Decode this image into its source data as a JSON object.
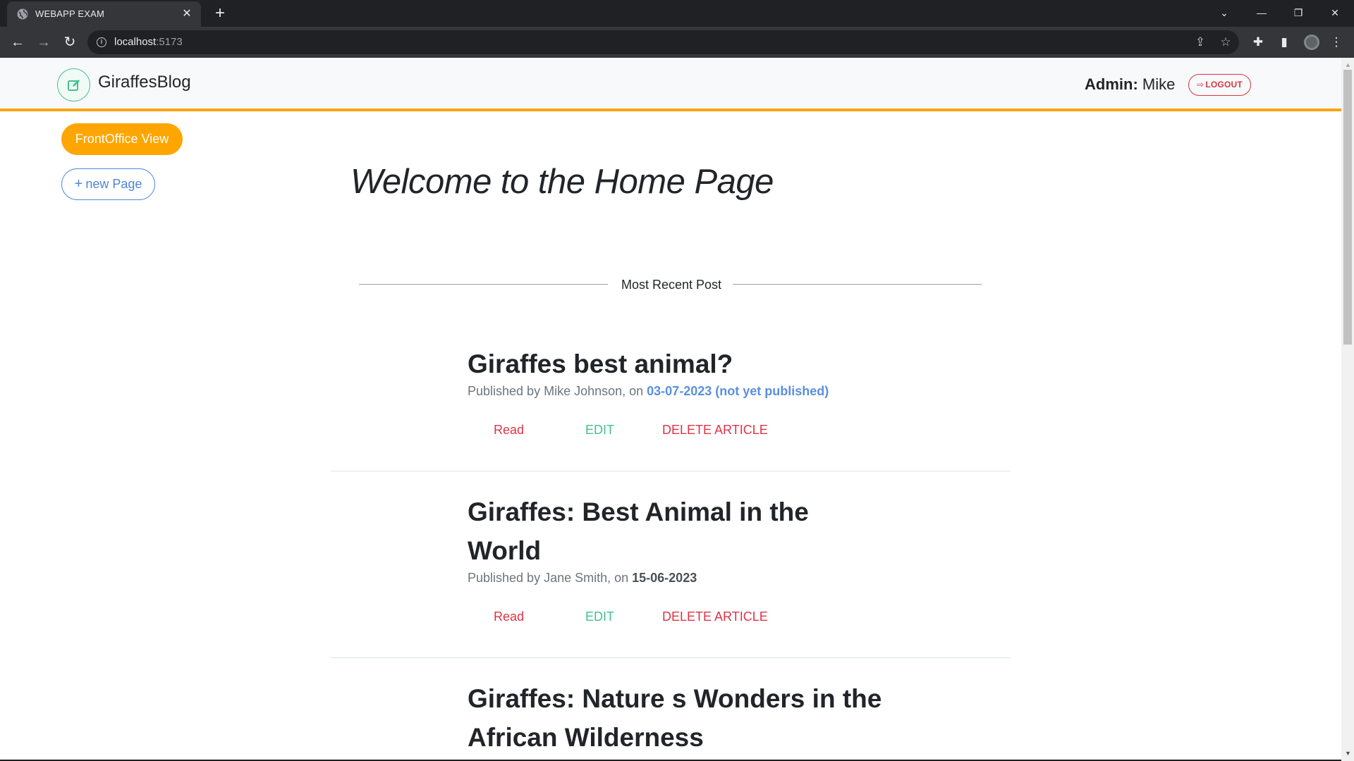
{
  "browser": {
    "tab_title": "WEBAPP EXAM",
    "tab_close": "✕",
    "new_tab": "+",
    "url_host": "localhost",
    "url_port": ":5173",
    "window_controls": {
      "chevron": "⌄",
      "minimize": "—",
      "restore": "❐",
      "close": "✕"
    }
  },
  "header": {
    "brand": "GiraffesBlog",
    "admin_label": "Admin:",
    "admin_name": "Mike",
    "logout_label": "LOGOUT"
  },
  "sidebar": {
    "frontoffice_label": "FrontOffice View",
    "new_page_label": "new Page"
  },
  "main": {
    "welcome_title": "Welcome to the Home Page",
    "section_label": "Most Recent Post"
  },
  "posts": [
    {
      "title": "Giraffes best animal?",
      "meta_prefix": "Published by Mike Johnson, on ",
      "date": "03-07-2023 (not yet published)",
      "read": "Read",
      "edit": "EDIT",
      "delete": "DELETE ARTICLE"
    },
    {
      "title": "Giraffes: Best Animal in the World",
      "meta_prefix": "Published by Jane Smith, on ",
      "date": "15-06-2023",
      "read": "Read",
      "edit": "EDIT",
      "delete": "DELETE ARTICLE"
    },
    {
      "title": "Giraffes: Nature s Wonders in the African Wilderness"
    }
  ],
  "colors": {
    "accent_orange": "#ffa500",
    "header_border": "#f9a30b",
    "danger": "#dc3545",
    "success": "#43c08e",
    "primary": "#4f86d9"
  }
}
